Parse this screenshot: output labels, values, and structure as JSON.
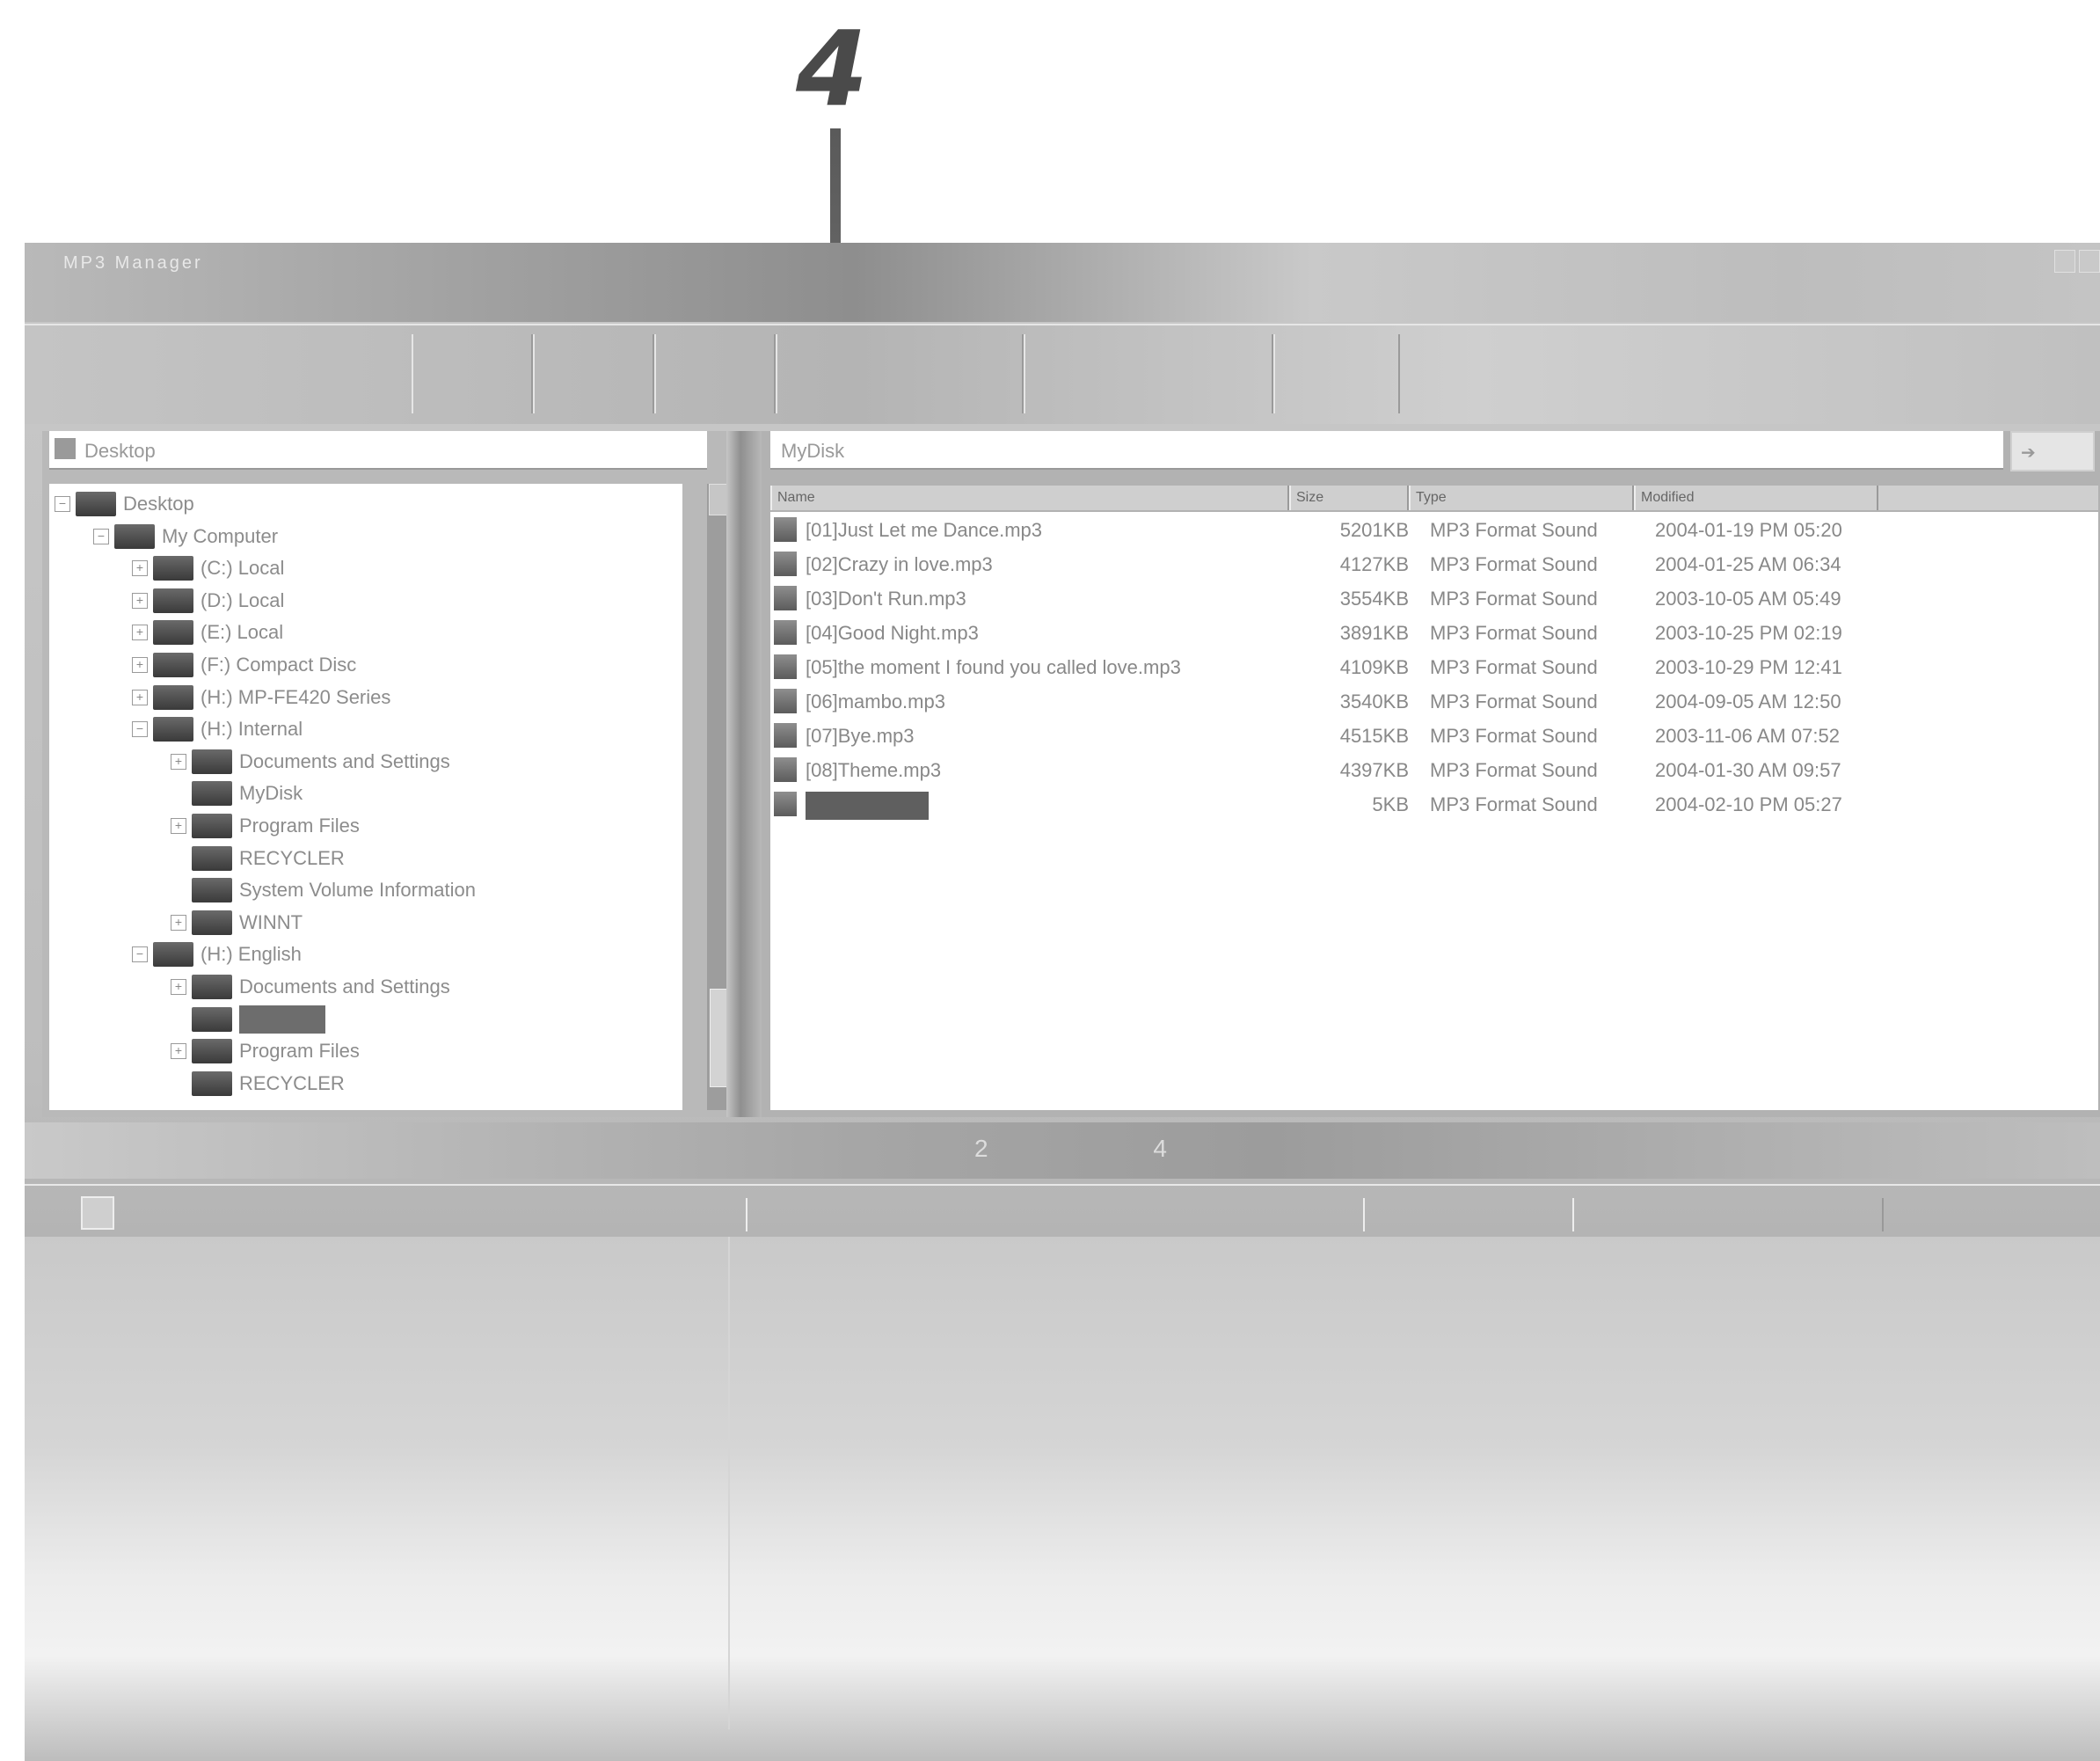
{
  "callout": {
    "number": "4"
  },
  "window": {
    "title": "MP3 Manager",
    "toolbar_buttons": [
      "",
      "",
      "",
      "",
      "",
      ""
    ]
  },
  "left_pane": {
    "header": "Desktop",
    "tree": [
      {
        "label": "Desktop",
        "level": 0,
        "expander": "−"
      },
      {
        "label": "My Computer",
        "level": 1,
        "expander": "−"
      },
      {
        "label": "(C:) Local",
        "level": 2,
        "expander": "+"
      },
      {
        "label": "(D:) Local",
        "level": 2,
        "expander": "+"
      },
      {
        "label": "(E:) Local",
        "level": 2,
        "expander": "+"
      },
      {
        "label": "(F:) Compact Disc",
        "level": 2,
        "expander": "+"
      },
      {
        "label": "(H:) MP-FE420 Series",
        "level": 2,
        "expander": "+"
      },
      {
        "label": "(H:) Internal",
        "level": 2,
        "expander": "−"
      },
      {
        "label": "Documents and Settings",
        "level": 3,
        "expander": "+"
      },
      {
        "label": "MyDisk",
        "level": 3,
        "expander": ""
      },
      {
        "label": "Program Files",
        "level": 3,
        "expander": "+"
      },
      {
        "label": "RECYCLER",
        "level": 3,
        "expander": ""
      },
      {
        "label": "System Volume Information",
        "level": 3,
        "expander": ""
      },
      {
        "label": "WINNT",
        "level": 3,
        "expander": "+"
      },
      {
        "label": "(H:) English",
        "level": 2,
        "expander": "−"
      },
      {
        "label": "Documents and Settings",
        "level": 3,
        "expander": "+"
      },
      {
        "label": "",
        "level": 3,
        "expander": "",
        "selected": true
      },
      {
        "label": "Program Files",
        "level": 3,
        "expander": "+"
      },
      {
        "label": "RECYCLER",
        "level": 3,
        "expander": ""
      }
    ]
  },
  "right_pane": {
    "address": "MyDisk",
    "go_icon": "go-icon",
    "columns": [
      "Name",
      "Size",
      "Type",
      "Modified"
    ],
    "files": [
      {
        "name": "[01]Just Let me Dance.mp3",
        "size": "5201KB",
        "type": "MP3 Format Sound",
        "date": "2004-01-19 PM 05:20"
      },
      {
        "name": "[02]Crazy in love.mp3",
        "size": "4127KB",
        "type": "MP3 Format Sound",
        "date": "2004-01-25 AM 06:34"
      },
      {
        "name": "[03]Don't Run.mp3",
        "size": "3554KB",
        "type": "MP3 Format Sound",
        "date": "2003-10-05 AM 05:49"
      },
      {
        "name": "[04]Good Night.mp3",
        "size": "3891KB",
        "type": "MP3 Format Sound",
        "date": "2003-10-25 PM 02:19"
      },
      {
        "name": "[05]the moment I found you called love.mp3",
        "size": "4109KB",
        "type": "MP3 Format Sound",
        "date": "2003-10-29 PM 12:41"
      },
      {
        "name": "[06]mambo.mp3",
        "size": "3540KB",
        "type": "MP3 Format Sound",
        "date": "2004-09-05 AM 12:50"
      },
      {
        "name": "[07]Bye.mp3",
        "size": "4515KB",
        "type": "MP3 Format Sound",
        "date": "2003-11-06 AM 07:52"
      },
      {
        "name": "[08]Theme.mp3",
        "size": "4397KB",
        "type": "MP3 Format Sound",
        "date": "2004-01-30 AM 09:57"
      },
      {
        "name": "",
        "size": "5KB",
        "type": "MP3 Format Sound",
        "date": "2004-02-10 PM 05:27",
        "selected": true
      }
    ]
  },
  "status": {
    "text": "2  4"
  }
}
